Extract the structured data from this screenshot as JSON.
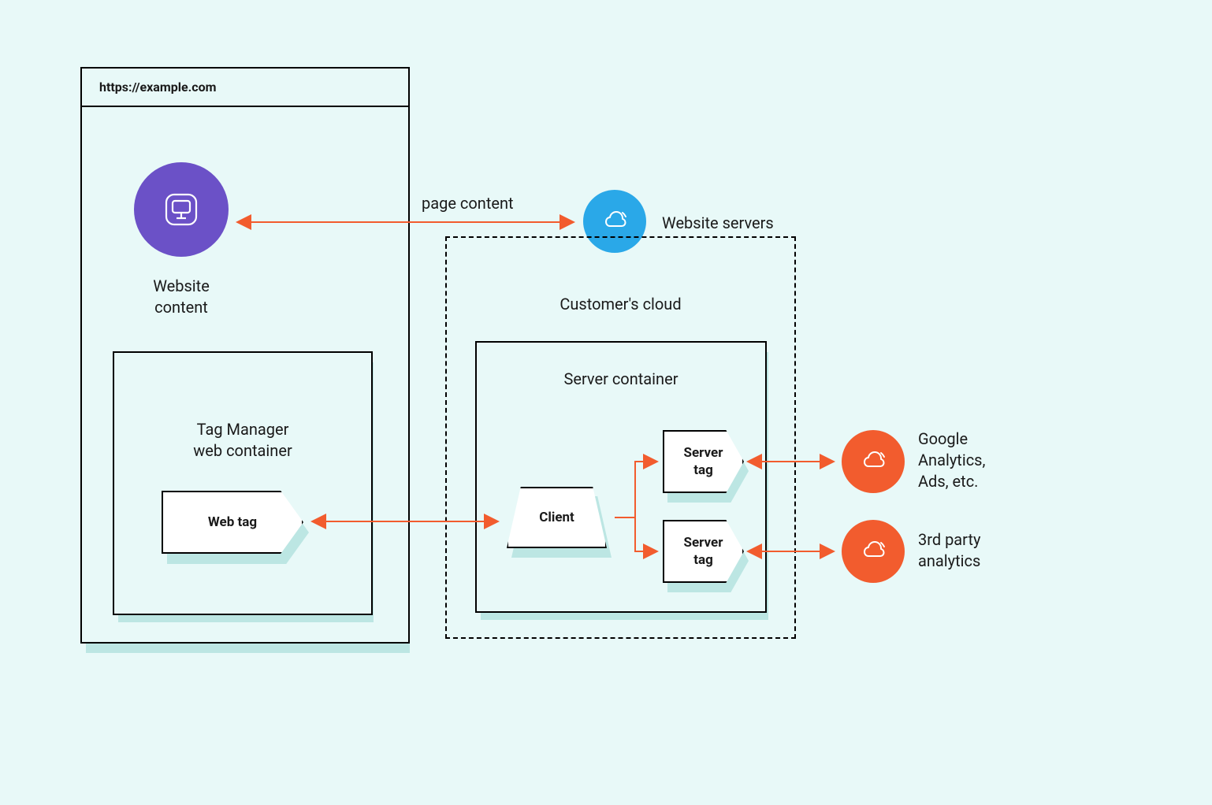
{
  "browser": {
    "url": "https://example.com"
  },
  "nodes": {
    "website_content_label": "Website\ncontent",
    "website_servers_label": "Website servers",
    "customers_cloud_label": "Customer's cloud",
    "server_container_label": "Server container",
    "tag_manager_label": "Tag Manager\nweb container",
    "web_tag_label": "Web tag",
    "client_label": "Client",
    "server_tag_1_label": "Server\ntag",
    "server_tag_2_label": "Server\ntag",
    "page_content_label": "page content",
    "ga_label": "Google\nAnalytics,\nAds, etc.",
    "third_party_label": "3rd party\nanalytics"
  },
  "colors": {
    "purple": "#6b51c7",
    "blue": "#2aa8e8",
    "orange": "#f25c2e",
    "arrow": "#f25c2e",
    "shadow": "#bce6e3",
    "bg": "#e8f9f8"
  }
}
